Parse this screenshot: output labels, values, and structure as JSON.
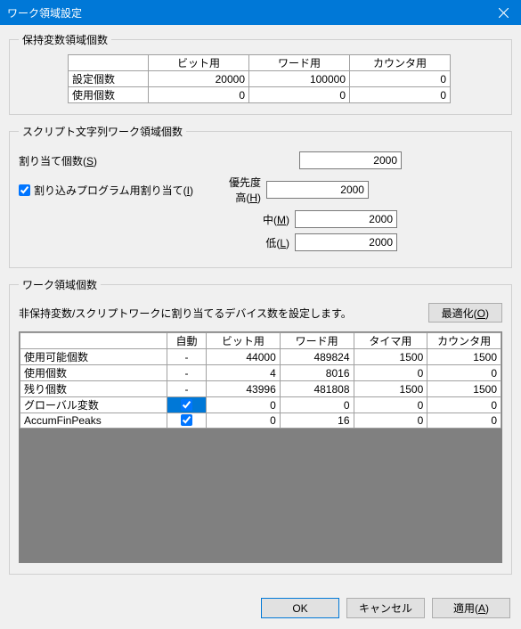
{
  "window": {
    "title": "ワーク領域設定"
  },
  "section1": {
    "legend": "保持変数領域個数",
    "cols": [
      "ビット用",
      "ワード用",
      "カウンタ用"
    ],
    "rows": [
      {
        "label": "設定個数",
        "bit": "20000",
        "word": "100000",
        "counter": "0"
      },
      {
        "label": "使用個数",
        "bit": "0",
        "word": "0",
        "counter": "0"
      }
    ]
  },
  "section2": {
    "legend": "スクリプト文字列ワーク領域個数",
    "alloc_label": "割り当て個数(S)",
    "alloc_value": "2000",
    "interrupt_label": "割り込みプログラム用割り当て(I)",
    "interrupt_checked": true,
    "hi_label": "優先度高(H)",
    "hi_value": "2000",
    "mid_label": "中(M)",
    "mid_value": "2000",
    "lo_label": "低(L)",
    "lo_value": "2000"
  },
  "section3": {
    "legend": "ワーク領域個数",
    "note": "非保持変数/スクリプトワークに割り当てるデバイス数を設定します。",
    "optimize": "最適化(O)",
    "cols": [
      "自動",
      "ビット用",
      "ワード用",
      "タイマ用",
      "カウンタ用"
    ],
    "rows": [
      {
        "label": "使用可能個数",
        "auto": "-",
        "bit": "44000",
        "word": "489824",
        "timer": "1500",
        "counter": "1500"
      },
      {
        "label": "使用個数",
        "auto": "-",
        "bit": "4",
        "word": "8016",
        "timer": "0",
        "counter": "0"
      },
      {
        "label": "残り個数",
        "auto": "-",
        "bit": "43996",
        "word": "481808",
        "timer": "1500",
        "counter": "1500"
      },
      {
        "label": "グローバル変数",
        "auto_check": true,
        "auto_selected": true,
        "bit": "0",
        "word": "0",
        "timer": "0",
        "counter": "0"
      },
      {
        "label": "AccumFinPeaks",
        "auto_check": true,
        "bit": "0",
        "word": "16",
        "timer": "0",
        "counter": "0"
      }
    ]
  },
  "buttons": {
    "ok": "OK",
    "cancel": "キャンセル",
    "apply": "適用(A)"
  }
}
